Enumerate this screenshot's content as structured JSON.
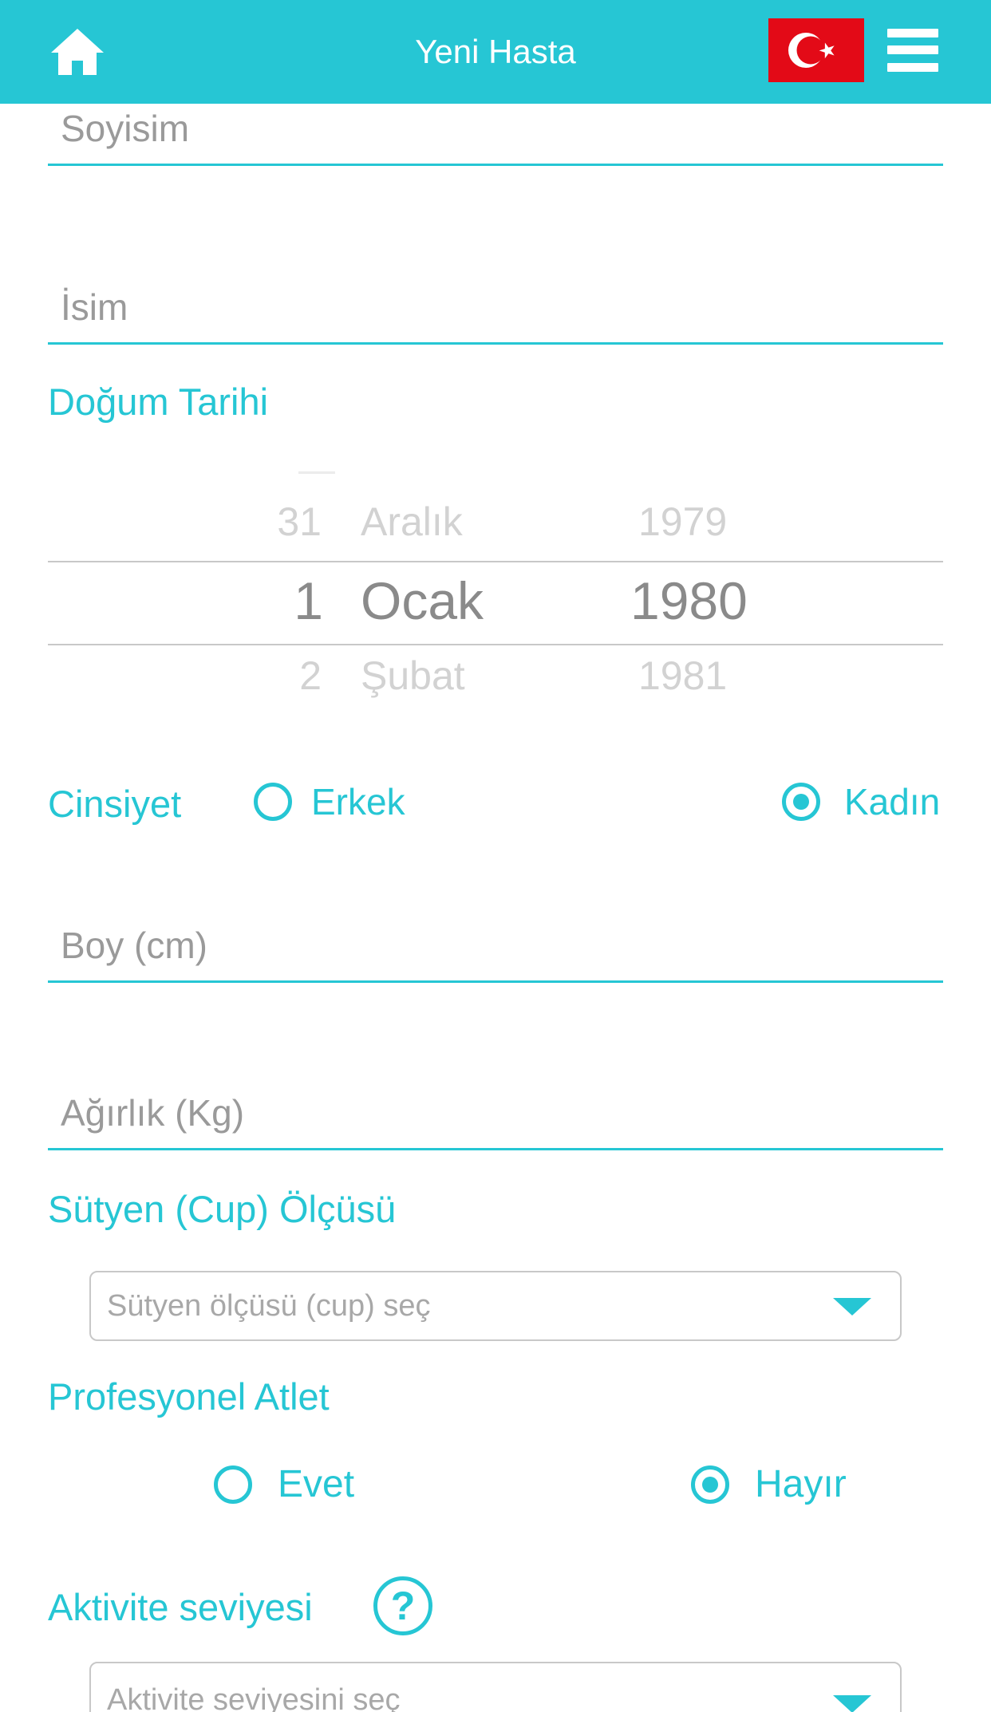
{
  "header": {
    "title": "Yeni Hasta",
    "home_icon": "home-icon",
    "flag_icon": "turkey-flag-icon",
    "menu_icon": "hamburger-menu-icon",
    "accent_color": "#26c6d4",
    "flag_color": "#e30a17"
  },
  "form": {
    "surname_placeholder": "Soyisim",
    "name_placeholder": "İsim",
    "birthdate_label": "Doğum Tarihi",
    "date_picker": {
      "day": {
        "prev": "31",
        "selected": "1",
        "next": "2"
      },
      "month": {
        "prev": "Aralık",
        "selected": "Ocak",
        "next": "Şubat"
      },
      "year": {
        "prev": "1979",
        "selected": "1980",
        "next": "1981"
      }
    },
    "gender": {
      "label": "Cinsiyet",
      "options": [
        {
          "label": "Erkek",
          "selected": false
        },
        {
          "label": "Kadın",
          "selected": true
        }
      ]
    },
    "height_placeholder": "Boy (cm)",
    "weight_placeholder": "Ağırlık (Kg)",
    "cup_size": {
      "label": "Sütyen (Cup) Ölçüsü",
      "placeholder": "Sütyen ölçüsü (cup) seç"
    },
    "pro_athlete": {
      "label": "Profesyonel Atlet",
      "options": [
        {
          "label": "Evet",
          "selected": false
        },
        {
          "label": "Hayır",
          "selected": true
        }
      ]
    },
    "activity": {
      "label": "Aktivite seviyesi",
      "help_icon": "question-mark-icon",
      "help_glyph": "?",
      "placeholder": "Aktivite seviyesini seç"
    }
  }
}
